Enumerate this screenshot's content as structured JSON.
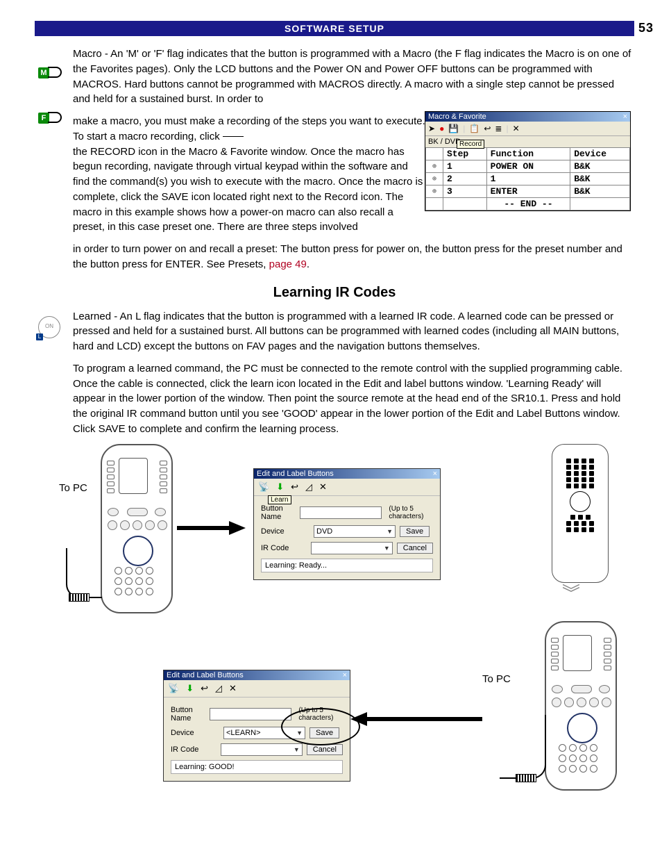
{
  "header": {
    "title": "SOFTWARE SETUP",
    "page_number": "53"
  },
  "flags": {
    "m": "M",
    "f": "F"
  },
  "macro_para_1": "Macro - An 'M' or 'F' flag indicates that the button is programmed with a Macro (the F flag indicates the Macro is on one of the Favorites pages). Only the LCD buttons and the Power ON and Power OFF buttons can be programmed with MACROS. Hard buttons cannot be programmed with MACROS directly.  A macro with a single step cannot be pressed and held for a sustained burst.  In order to",
  "macro_para_2a": "make a macro, you must make a recording of the steps you want to execute.  To start a macro recording, click",
  "macro_para_2b": "the RECORD icon in the Macro & Favorite window.  Once the macro has begun recording, navigate through virtual keypad within the software and find the command(s) you wish to execute with the macro.  Once the macro is complete, click the SAVE icon located right next to the Record icon.  The macro in this example shows how a power-on macro can also recall a preset, in this case preset one. There are three steps involved",
  "macro_para_3": "in order to turn power on and recall a preset: The button press for power on, the button press for the preset number and the button press for ENTER.    See Presets, ",
  "macro_link": "page 49",
  "macro_window": {
    "title": "Macro & Favorite",
    "tooltip": "Record",
    "tab": "BK / DVD",
    "headers": {
      "step": "Step",
      "function": "Function",
      "device": "Device"
    },
    "rows": [
      {
        "step": "1",
        "function": "POWER ON",
        "device": "B&K"
      },
      {
        "step": "2",
        "function": "1",
        "device": "B&K"
      },
      {
        "step": "3",
        "function": "ENTER",
        "device": "B&K"
      }
    ],
    "end_row": "--  END  --"
  },
  "section_title": "Learning IR Codes",
  "learned_icon_text": "ON",
  "learned_para_1": "Learned - An L flag indicates that the button is programmed with a learned IR code.  A learned code can be pressed or pressed and held for a sustained burst.  All buttons can be programmed with learned codes (including all MAIN buttons, hard and LCD) except the buttons on FAV pages and the navigation buttons themselves.",
  "learned_para_2": "To program a learned command, the PC must be connected to the remote control with the supplied programming cable.  Once the cable is connected, click the learn icon located in the Edit and label buttons window.  'Learning Ready' will appear in the lower portion of the window. Then point the source remote at the head end of the SR10.1.  Press and hold the original IR command button until you see 'GOOD' appear in the lower portion of the Edit and Label Buttons window.  Click SAVE to complete and confirm the learning process.",
  "to_pc": "To PC",
  "edit_window_1": {
    "title": "Edit and Label Buttons",
    "tooltip": "Learn",
    "name_label": "Button Name",
    "name_value": "",
    "hint": "(Up to 5 characters)",
    "device_label": "Device",
    "device_value": "DVD",
    "ircode_label": "IR Code",
    "ircode_value": "",
    "save": "Save",
    "cancel": "Cancel",
    "status": "Learning: Ready..."
  },
  "edit_window_2": {
    "title": "Edit and Label Buttons",
    "name_label": "Button Name",
    "name_value": "",
    "hint": "(Up to 5 characters)",
    "device_label": "Device",
    "device_value": "<LEARN>",
    "ircode_label": "IR Code",
    "ircode_value": "",
    "save": "Save",
    "cancel": "Cancel",
    "status": "Learning: GOOD!"
  }
}
